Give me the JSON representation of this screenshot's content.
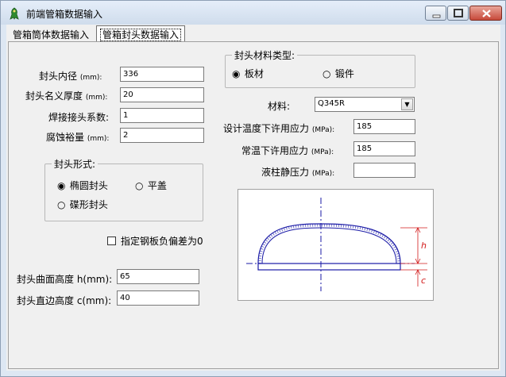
{
  "window": {
    "title": "前端管箱数据输入"
  },
  "tabs": [
    {
      "label": "管箱筒体数据输入"
    },
    {
      "label": "管箱封头数据输入"
    }
  ],
  "left": {
    "inner_diameter_label": "封头内径",
    "inner_diameter_unit": "(mm):",
    "inner_diameter_value": "336",
    "nominal_thickness_label": "封头名义厚度",
    "nominal_thickness_unit": "(mm):",
    "nominal_thickness_value": "20",
    "weld_coeff_label": "焊接接头系数:",
    "weld_coeff_value": "1",
    "corrosion_label": "腐蚀裕量",
    "corrosion_unit": "(mm):",
    "corrosion_value": "2",
    "head_type": {
      "title": "封头形式:",
      "options": [
        "椭圆封头",
        "平盖",
        "碟形封头"
      ],
      "selected": "椭圆封头"
    },
    "neg_tolerance_label": "指定钢板负偏差为0",
    "curve_height_label": "封头曲面高度 h(mm):",
    "curve_height_value": "65",
    "straight_height_label": "封头直边高度 c(mm):",
    "straight_height_value": "40"
  },
  "right": {
    "material_type": {
      "title": "封头材料类型:",
      "options": [
        "板材",
        "锻件"
      ],
      "selected": "板材"
    },
    "material_label": "材料:",
    "material_value": "Q345R",
    "design_stress_label": "设计温度下许用应力",
    "design_stress_unit": "(MPa):",
    "design_stress_value": "185",
    "normal_stress_label": "常温下许用应力",
    "normal_stress_unit": "(MPa):",
    "normal_stress_value": "185",
    "liquid_pressure_label": "液柱静压力",
    "liquid_pressure_unit": "(MPa):",
    "liquid_pressure_value": ""
  },
  "diagram": {
    "h_label": "h",
    "c_label": "c"
  },
  "colors": {
    "diagram_blue": "#1a1aa6",
    "dimension_red": "#d21a1a"
  }
}
